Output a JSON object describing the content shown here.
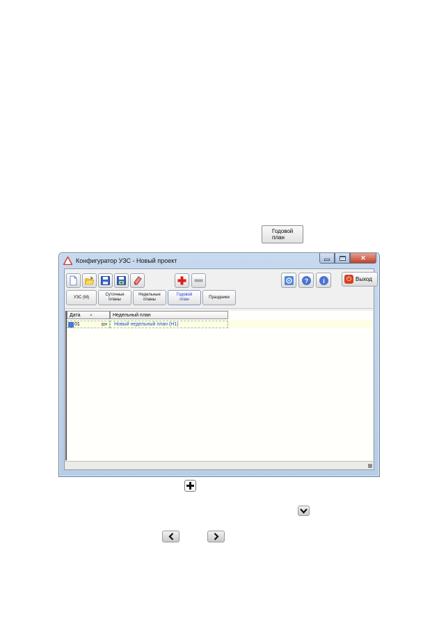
{
  "standalone_button": {
    "label_line1": "Годовой",
    "label_line2": "план"
  },
  "window": {
    "title": "Конфигуратор УЗС - Новый проект",
    "toolbar": {
      "new_icon": "new-file-icon",
      "open_icon": "open-folder-icon",
      "save_icon": "save-icon",
      "save_as_icon": "save-as-icon",
      "clear_icon": "eraser-icon",
      "add_icon": "plus-icon",
      "remove_icon": "minus-icon",
      "settings_icon": "settings-icon",
      "help_icon": "help-icon",
      "info_icon": "info-icon",
      "exit_label": "Выход"
    },
    "nav": {
      "uzs": "УЗС (М)",
      "daily_line1": "Суточные",
      "daily_line2": "планы",
      "weekly_line1": "Недельные",
      "weekly_line2": "планы",
      "yearly_line1": "Годовой",
      "yearly_line2": "план",
      "holidays": "Праздники"
    },
    "grid": {
      "col_date": "Дата",
      "col_plan": "Недельный план",
      "rows": [
        {
          "date": "01",
          "plan": "Новый недельный план (Н1)"
        }
      ]
    }
  },
  "bottom_icons": {
    "plus": "plus-icon",
    "chevron_down": "chevron-down-icon",
    "left": "chevron-left-icon",
    "right": "chevron-right-icon"
  },
  "colors": {
    "accent_blue": "#1a3ccf",
    "close_red": "#c2412a",
    "exit_red": "#d7411e",
    "add_red": "#e01b1b"
  }
}
